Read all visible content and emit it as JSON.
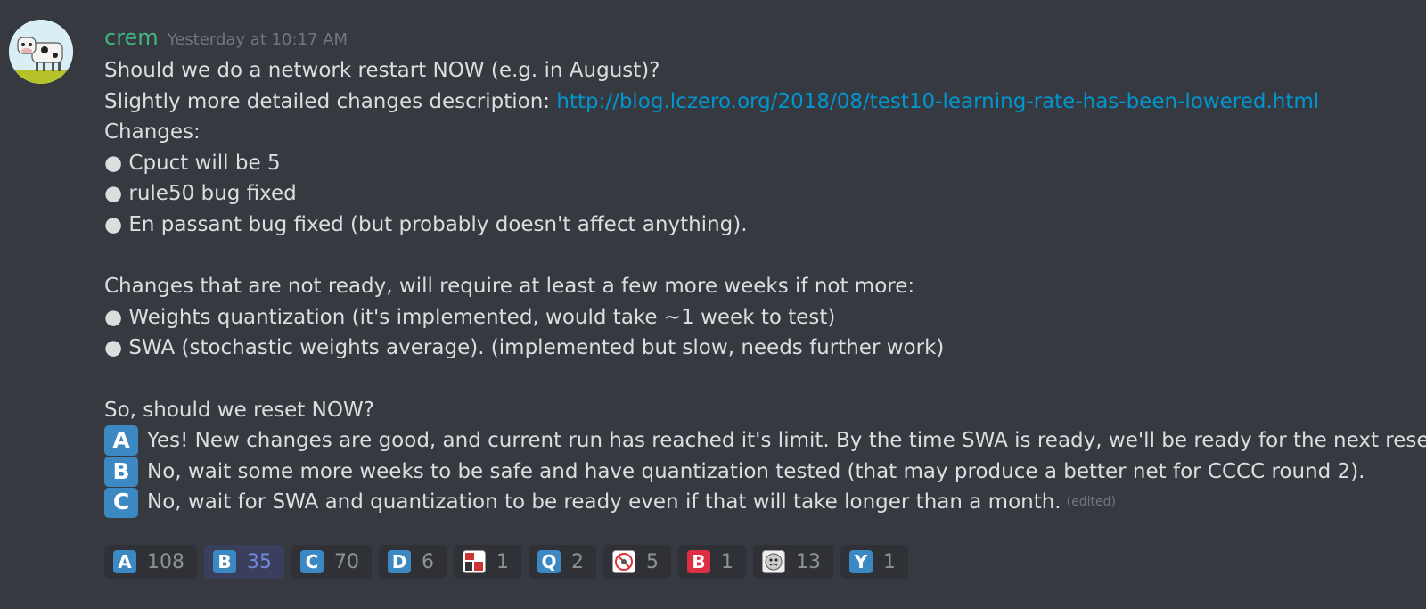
{
  "message": {
    "username": "crem",
    "timestamp": "Yesterday at 10:17 AM",
    "lines": [
      "Should we do a network restart NOW (e.g. in August)?",
      "Slightly more detailed changes description: ",
      "Changes:",
      "● Cpuct will be 5",
      "● rule50 bug fixed",
      "● En passant bug fixed (but probably doesn't affect anything).",
      "Changes that are not ready, will require at least a few more weeks if not more:",
      "● Weights quantization (it's implemented, would take ~1 week to test)",
      "● SWA (stochastic weights average). (implemented but slow, needs further work)",
      "So, should we reset NOW?"
    ],
    "link": "http://blog.lczero.org/2018/08/test10-learning-rate-has-been-lowered.html",
    "options": [
      {
        "letter": "A",
        "text": "Yes! New changes are good, and current run has reached it's limit. By the time SWA is ready, we'll be ready for the next reset!"
      },
      {
        "letter": "B",
        "text": "No, wait some more weeks to be safe and have quantization tested (that may produce a better net for CCCC round 2)."
      },
      {
        "letter": "C",
        "text": "No, wait for SWA and quantization to be ready even if that will take longer than a month."
      }
    ],
    "edited_label": "(edited)"
  },
  "reactions": [
    {
      "emoji": "A",
      "icon": "regional-indicator-a-icon",
      "count": "108"
    },
    {
      "emoji": "B",
      "icon": "regional-indicator-b-icon",
      "count": "35"
    },
    {
      "emoji": "C",
      "icon": "regional-indicator-c-icon",
      "count": "70"
    },
    {
      "emoji": "D",
      "icon": "regional-indicator-d-icon",
      "count": "6"
    },
    {
      "emoji": "",
      "icon": "custom-emoji-image-icon",
      "count": "1"
    },
    {
      "emoji": "Q",
      "icon": "regional-indicator-q-icon",
      "count": "2"
    },
    {
      "emoji": "",
      "icon": "custom-emoji-image-icon",
      "count": "5"
    },
    {
      "emoji": "B",
      "icon": "red-b-button-icon",
      "count": "1"
    },
    {
      "emoji": "",
      "icon": "custom-emoji-image-icon",
      "count": "13"
    },
    {
      "emoji": "Y",
      "icon": "regional-indicator-y-icon",
      "count": "1"
    }
  ],
  "colors": {
    "background": "#36393f",
    "username": "#43b581",
    "link": "#0096cf",
    "emoji_blue": "#3b88c3",
    "emoji_red": "#dd2e44"
  }
}
